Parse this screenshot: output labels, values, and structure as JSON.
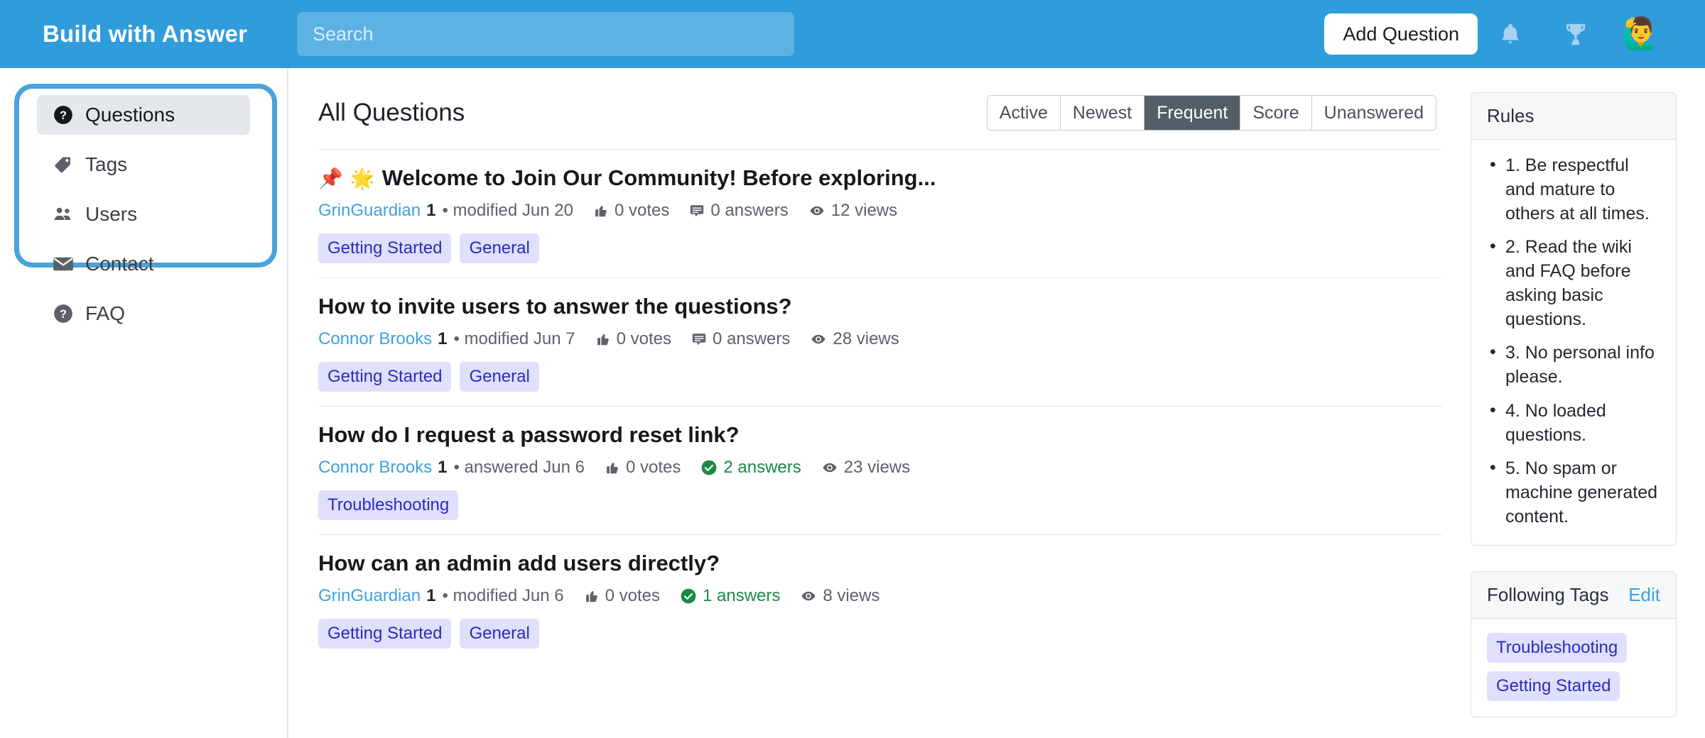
{
  "header": {
    "brand": "Build with Answer",
    "search_placeholder": "Search",
    "search_value": "",
    "add_question_label": "Add Question",
    "icons": [
      "bell-icon",
      "trophy-icon"
    ],
    "avatar_glyph": "🙋‍♂️",
    "bg_color": "#2f9ddb"
  },
  "sidebar": {
    "items": [
      {
        "label": "Questions",
        "icon": "question-circle-icon",
        "active": true
      },
      {
        "label": "Tags",
        "icon": "tag-icon",
        "active": false
      },
      {
        "label": "Users",
        "icon": "users-icon",
        "active": false
      },
      {
        "label": "Contact",
        "icon": "envelope-icon",
        "active": false
      },
      {
        "label": "FAQ",
        "icon": "question-circle-icon",
        "active": false
      }
    ],
    "highlight_color": "#4aa3dc"
  },
  "main": {
    "title": "All Questions",
    "tabs": [
      {
        "label": "Active",
        "selected": false
      },
      {
        "label": "Newest",
        "selected": false
      },
      {
        "label": "Frequent",
        "selected": true
      },
      {
        "label": "Score",
        "selected": false
      },
      {
        "label": "Unanswered",
        "selected": false
      }
    ],
    "questions": [
      {
        "pinned": true,
        "pin_glyph": "📌",
        "emoji": "🌟",
        "title": "Welcome to Join Our Community! Before exploring...",
        "author": "GrinGuardian",
        "reputation": "1",
        "separator": "•",
        "activity": "modified Jun 20",
        "votes": "0 votes",
        "answers": "0 answers",
        "answered": false,
        "views": "12 views",
        "tags": [
          "Getting Started",
          "General"
        ]
      },
      {
        "pinned": false,
        "pin_glyph": "",
        "emoji": "",
        "title": "How to invite users to answer the questions?",
        "author": "Connor Brooks",
        "reputation": "1",
        "separator": "•",
        "activity": "modified Jun 7",
        "votes": "0 votes",
        "answers": "0 answers",
        "answered": false,
        "views": "28 views",
        "tags": [
          "Getting Started",
          "General"
        ]
      },
      {
        "pinned": false,
        "pin_glyph": "",
        "emoji": "",
        "title": "How do I request a password reset link?",
        "author": "Connor Brooks",
        "reputation": "1",
        "separator": "•",
        "activity": "answered Jun 6",
        "votes": "0 votes",
        "answers": "2 answers",
        "answered": true,
        "views": "23 views",
        "tags": [
          "Troubleshooting"
        ]
      },
      {
        "pinned": false,
        "pin_glyph": "",
        "emoji": "",
        "title": "How can an admin add users directly?",
        "author": "GrinGuardian",
        "reputation": "1",
        "separator": "•",
        "activity": "modified Jun 6",
        "votes": "0 votes",
        "answers": "1 answers",
        "answered": true,
        "views": "8 views",
        "tags": [
          "Getting Started",
          "General"
        ]
      }
    ]
  },
  "rail": {
    "rules": {
      "title": "Rules",
      "items": [
        "1. Be respectful and mature to others at all times.",
        "2. Read the wiki and FAQ before asking basic questions.",
        "3. No personal info please.",
        "4. No loaded questions.",
        "5. No spam or machine generated content."
      ]
    },
    "following_tags": {
      "title": "Following Tags",
      "edit_label": "Edit",
      "tags": [
        "Troubleshooting",
        "Getting Started"
      ]
    }
  },
  "colors": {
    "brand_blue": "#2f9ddb",
    "link_blue": "#3fa0e0",
    "tag_bg": "#dfe0fb",
    "tag_text": "#2b2bbf",
    "answered_green": "#1a8a45",
    "tab_selected_bg": "#525e68"
  }
}
